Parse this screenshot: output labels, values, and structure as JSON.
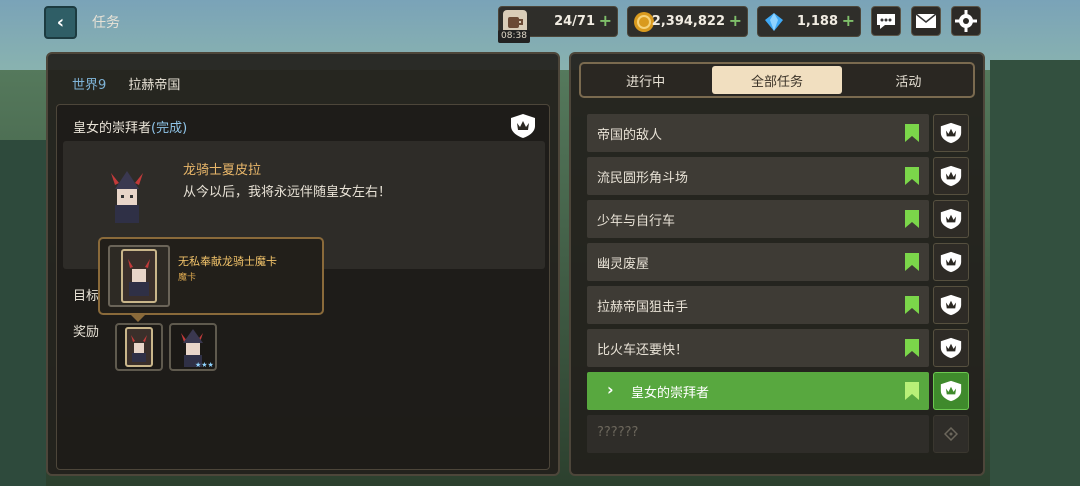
{
  "header": {
    "back_label": "‹",
    "title": "任务",
    "stamina": {
      "icon": "coffee-icon",
      "value": "24/71",
      "plus": "+",
      "timer": "08:38"
    },
    "gold": {
      "icon": "gold-coin-icon",
      "value": "2,394,822",
      "plus": "+"
    },
    "gems": {
      "icon": "diamond-icon",
      "value": "1,188",
      "plus": "+"
    },
    "buttons": [
      "chat-icon",
      "mail-icon",
      "settings-icon"
    ]
  },
  "left": {
    "world": "世界9",
    "region": "拉赫帝国",
    "quest_title": "皇女的崇拜者",
    "quest_status": "(完成)",
    "speaker": "龙骑士夏皮拉",
    "speech": "从今以后，我将永远伴随皇女左右！",
    "goal_label": "目标",
    "reward_label": "奖励",
    "tooltip": {
      "name": "无私奉献龙骑士魔卡",
      "type": "魔卡"
    }
  },
  "right": {
    "tabs": [
      {
        "label": "进行中",
        "active": false
      },
      {
        "label": "全部任务",
        "active": true
      },
      {
        "label": "活动",
        "active": false
      }
    ],
    "quests": [
      {
        "name": "帝国的敌人",
        "state": "normal"
      },
      {
        "name": "流民圆形角斗场",
        "state": "normal"
      },
      {
        "name": "少年与自行车",
        "state": "normal"
      },
      {
        "name": "幽灵废屋",
        "state": "normal"
      },
      {
        "name": "拉赫帝国狙击手",
        "state": "normal"
      },
      {
        "name": "比火车还要快！",
        "state": "normal"
      },
      {
        "name": "皇女的崇拜者",
        "state": "active"
      },
      {
        "name": "??????",
        "state": "locked"
      }
    ]
  },
  "colors": {
    "accent_green": "#58a83f",
    "gold_text": "#f2c36a",
    "blue_text": "#7fb4d8"
  }
}
